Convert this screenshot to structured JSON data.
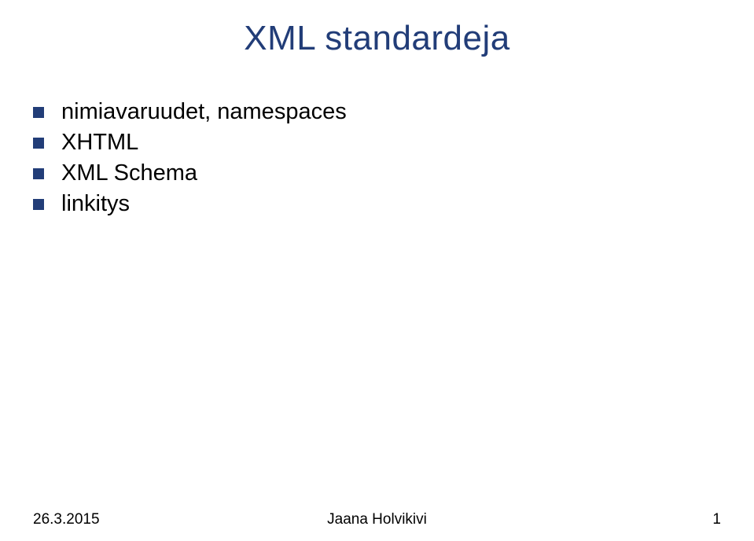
{
  "title": "XML standardeja",
  "bullets": [
    "nimiavaruudet, namespaces",
    "XHTML",
    "XML Schema",
    "linkitys"
  ],
  "footer": {
    "date": "26.3.2015",
    "author": "Jaana Holvikivi",
    "page": "1"
  }
}
